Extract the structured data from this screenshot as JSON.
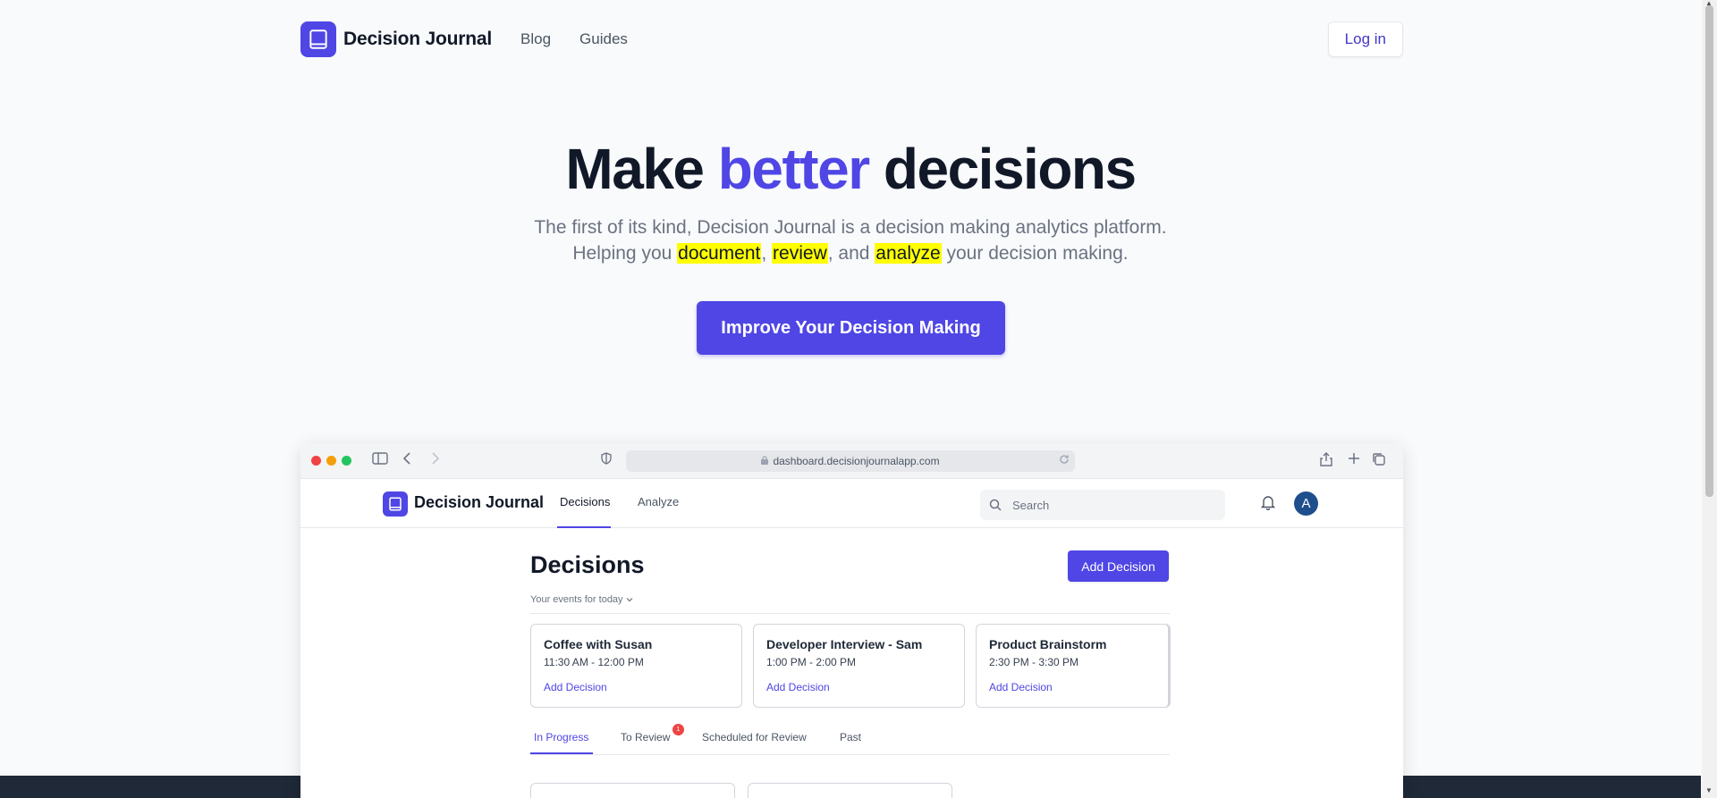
{
  "header": {
    "brand": "Decision Journal",
    "nav": [
      "Blog",
      "Guides"
    ],
    "login_label": "Log in"
  },
  "hero": {
    "title_pre": "Make ",
    "title_accent": "better",
    "title_post": " decisions",
    "sub_line1": "The first of its kind, Decision Journal is a decision making analytics platform.",
    "sub_line2_a": "Helping you ",
    "hl_1": "document",
    "sub_line2_b": ", ",
    "hl_2": "review",
    "sub_line2_c": ", and ",
    "hl_3": "analyze",
    "sub_line2_d": " your decision making.",
    "cta_label": "Improve Your Decision Making"
  },
  "browser": {
    "url": "dashboard.decisionjournalapp.com",
    "app": {
      "brand": "Decision Journal",
      "tabs": [
        "Decisions",
        "Analyze"
      ],
      "search_placeholder": "Search",
      "avatar_initial": "A",
      "page_title": "Decisions",
      "add_button": "Add Decision",
      "events_label": "Your events for today",
      "events": [
        {
          "title": "Coffee with Susan",
          "time": "11:30 AM - 12:00 PM",
          "link": "Add Decision"
        },
        {
          "title": "Developer Interview - Sam",
          "time": "1:00 PM - 2:00 PM",
          "link": "Add Decision"
        },
        {
          "title": "Product Brainstorm",
          "time": "2:30 PM - 3:30 PM",
          "link": "Add Decision"
        }
      ],
      "decision_tabs": [
        "In Progress",
        "To Review",
        "Scheduled for Review",
        "Past"
      ],
      "to_review_count": "1"
    }
  },
  "colors": {
    "accent": "#4f46e5",
    "highlight": "#ffff00",
    "dark_band": "#1f2937"
  }
}
